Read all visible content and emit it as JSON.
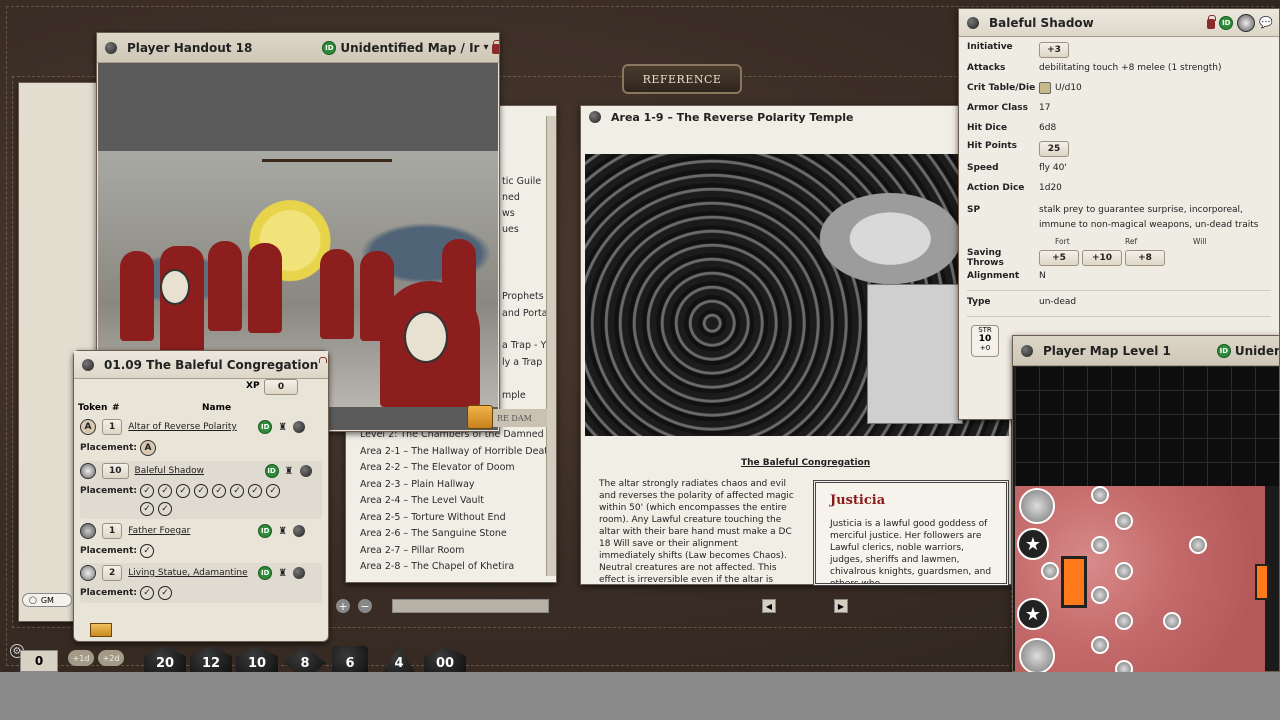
{
  "reference_label": "REFERENCE",
  "handout": {
    "title": "Player Handout 18",
    "map_label": "Unidentified Map / Ir",
    "tooltip": "RE DAM"
  },
  "congregation": {
    "title": "01.09 The Baleful Congregation",
    "xp_label": "XP",
    "xp_value": "0",
    "col_token": "Token",
    "col_num": "#",
    "col_name": "Name",
    "placement_label": "Placement:",
    "rows": [
      {
        "token": "A",
        "count": "1",
        "name": "Altar of Reverse Polarity"
      },
      {
        "token": "",
        "count": "10",
        "name": "Baleful Shadow"
      },
      {
        "token": "",
        "count": "1",
        "name": "Father Foegar"
      },
      {
        "token": "",
        "count": "2",
        "name": "Living Statue, Adamantine"
      }
    ]
  },
  "index": {
    "partial_items": [
      "tic Guile",
      "ned",
      "ws",
      "ues",
      "Prophets",
      "and Porta",
      "a Trap - Y",
      "ly a Trap",
      "mple",
      "Level 2: The Chambers of the Damned"
    ],
    "items": [
      "Area 2-1 – The Hallway of Horrible Death",
      "Area 2-2 – The Elevator of Doom",
      "Area 2-3 – Plain Hallway",
      "Area 2-4 – The Level Vault",
      "Area 2-5 – Torture Without End",
      "Area 2-6 – The Sanguine Stone",
      "Area 2-7 – Pillar Room",
      "Area 2-8 – The Chapel of Khetira"
    ]
  },
  "area": {
    "title": "Area 1-9 – The Reverse Polarity Temple",
    "caption": "The Baleful Congregation",
    "body": "The altar strongly radiates chaos and evil and reverses the polarity of affected magic within 50' (which encompasses the entire room). Any Lawful creature touching the altar with their bare hand must make a DC 18 Will save or their alignment immediately shifts (Law becomes Chaos). Neutral creatures are not affected. This effect is irreversible even if the altar is",
    "justicia_title": "Justicia",
    "justicia_body": "Justicia is a lawful good goddess of merciful justice. Her followers are Lawful clerics, noble warriors, judges, sheriffs and lawmen, chivalrous knights, guardsmen, and others who"
  },
  "shadow": {
    "title": "Baleful Shadow",
    "initiative_label": "Initiative",
    "initiative": "+3",
    "attacks_label": "Attacks",
    "attacks": "debilitating touch +8 melee (1 strength)",
    "crit_label": "Crit Table/Die",
    "crit": "U/d10",
    "ac_label": "Armor Class",
    "ac": "17",
    "hd_label": "Hit Dice",
    "hd": "6d8",
    "hp_label": "Hit Points",
    "hp": "25",
    "speed_label": "Speed",
    "speed": "fly 40'",
    "action_label": "Action Dice",
    "action": "1d20",
    "sp_label": "SP",
    "sp": "stalk prey to guarantee surprise, incorporeal, immune to non-magical weapons, un-dead traits",
    "saves_label": "Saving Throws",
    "fort_label": "Fort",
    "fort": "+5",
    "ref_label": "Ref",
    "ref": "+10",
    "will_label": "Will",
    "will": "+8",
    "alignment_label": "Alignment",
    "alignment": "N",
    "type_label": "Type",
    "type": "un-dead",
    "str_label": "STR",
    "str": "10",
    "str_mod": "+0"
  },
  "map": {
    "title": "Player Map Level 1",
    "label": "Unidentif"
  },
  "chat": {
    "gm_label": "GM"
  },
  "dice": {
    "modifier": "0",
    "plus_d4": "+1d",
    "plus_d8": "+2d",
    "labels": [
      "20",
      "12",
      "10",
      "8",
      "6",
      "4",
      "00"
    ]
  }
}
